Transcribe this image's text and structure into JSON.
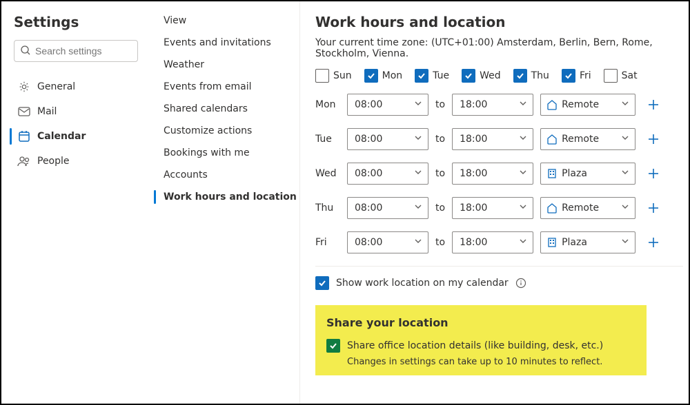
{
  "hero": "Settings",
  "search_placeholder": "Search settings",
  "cats": [
    {
      "label": "General"
    },
    {
      "label": "Mail"
    },
    {
      "label": "Calendar"
    },
    {
      "label": "People"
    }
  ],
  "subs": [
    "View",
    "Events and invitations",
    "Weather",
    "Events from email",
    "Shared calendars",
    "Customize actions",
    "Bookings with me",
    "Accounts",
    "Work hours and location"
  ],
  "page_title": "Work hours and location",
  "tz_line": "Your current time zone: (UTC+01:00) Amsterdam, Berlin, Bern, Rome, Stockholm, Vienna.",
  "days": [
    {
      "short": "Sun",
      "checked": false
    },
    {
      "short": "Mon",
      "checked": true
    },
    {
      "short": "Tue",
      "checked": true
    },
    {
      "short": "Wed",
      "checked": true
    },
    {
      "short": "Thu",
      "checked": true
    },
    {
      "short": "Fri",
      "checked": true
    },
    {
      "short": "Sat",
      "checked": false
    }
  ],
  "hours": [
    {
      "day": "Mon",
      "start": "08:00",
      "end": "18:00",
      "loc": "Remote",
      "icon": "home"
    },
    {
      "day": "Tue",
      "start": "08:00",
      "end": "18:00",
      "loc": "Remote",
      "icon": "home"
    },
    {
      "day": "Wed",
      "start": "08:00",
      "end": "18:00",
      "loc": "Plaza",
      "icon": "building"
    },
    {
      "day": "Thu",
      "start": "08:00",
      "end": "18:00",
      "loc": "Remote",
      "icon": "home"
    },
    {
      "day": "Fri",
      "start": "08:00",
      "end": "18:00",
      "loc": "Plaza",
      "icon": "building"
    }
  ],
  "to_label": "to",
  "showloc_label": "Show work location on my calendar",
  "share_heading": "Share your location",
  "share_label": "Share office location details (like building, desk, etc.)",
  "share_note": "Changes in settings can take up to 10 minutes to reflect."
}
